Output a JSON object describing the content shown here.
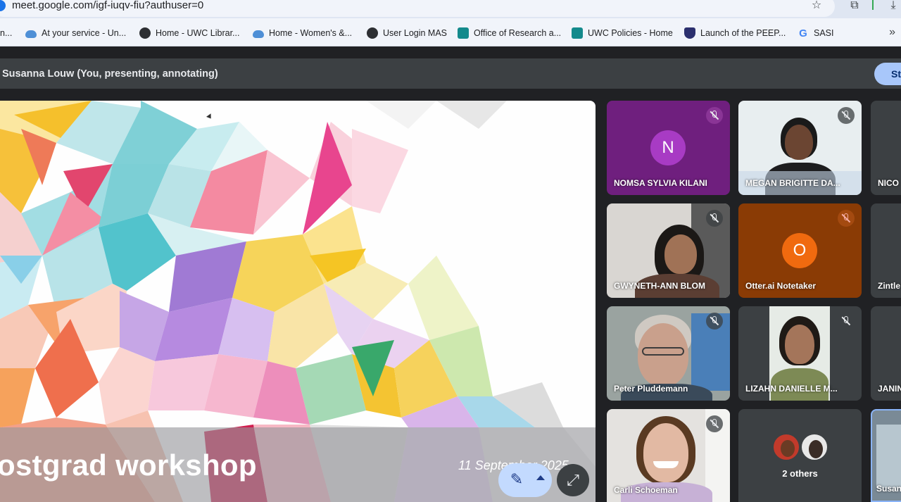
{
  "browser": {
    "url": "meet.google.com/igf-iuqv-fiu?authuser=0",
    "bookmarks": [
      {
        "label": "n...",
        "icon": "none"
      },
      {
        "label": "At your service - Un...",
        "icon": "cloud-icon"
      },
      {
        "label": "Home - UWC Librar...",
        "icon": "globe-icon"
      },
      {
        "label": "Home - Women's &...",
        "icon": "cloud-icon"
      },
      {
        "label": "User Login MAS",
        "icon": "globe-icon"
      },
      {
        "label": "Office of Research a...",
        "icon": "sharepoint-icon"
      },
      {
        "label": "UWC Policies - Home",
        "icon": "sharepoint-icon"
      },
      {
        "label": "Launch of the PEEP...",
        "icon": "shield-icon"
      },
      {
        "label": "SASI",
        "icon": "google-icon"
      }
    ],
    "more_bookmarks_glyph": "»"
  },
  "meet": {
    "presenting_label": "Susanna Louw (You, presenting, annotating)",
    "stop_button_label": "St",
    "slide": {
      "title": "ostgrad workshop",
      "date": "11 September 2025"
    },
    "participants": [
      {
        "name": "NOMSA SYLVIA KILANI",
        "avatar_letter": "N",
        "avatar_color": "#a83bc4",
        "tile_color": "#6f1f7e",
        "mic": "muted"
      },
      {
        "name": "MEGAN BRIGITTE DA...",
        "mic": "muted"
      },
      {
        "name": "NICO",
        "mic": "none"
      },
      {
        "name": "GWYNETH-ANN BLOM",
        "mic": "muted"
      },
      {
        "name": "Otter.ai Notetaker",
        "avatar_letter": "O",
        "avatar_color": "#f06a0f",
        "tile_color": "#8a3b05",
        "mic": "muted-red"
      },
      {
        "name": "Zintle",
        "mic": "none"
      },
      {
        "name": "Peter Pluddemann",
        "mic": "muted"
      },
      {
        "name": "LIZAHN DANIELLE M...",
        "mic": "muted"
      },
      {
        "name": "JANIN",
        "mic": "none"
      },
      {
        "name": "Carli Schoeman",
        "mic": "muted"
      },
      {
        "name": "2 others",
        "mic": "none"
      },
      {
        "name": "Susan",
        "mic": "none"
      }
    ]
  }
}
